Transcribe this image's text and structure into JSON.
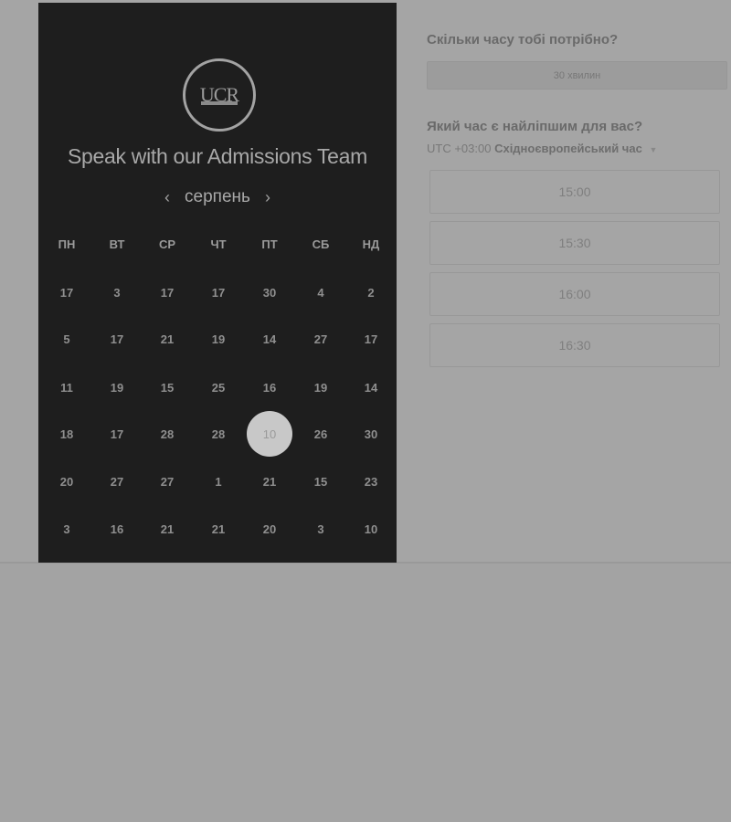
{
  "left": {
    "logo_text": "UCR",
    "headline": "Speak with our Admissions Team",
    "month": "серпень",
    "prev_arrow": "‹",
    "next_arrow": "›",
    "weekdays": [
      "ПН",
      "ВТ",
      "СР",
      "ЧТ",
      "ПТ",
      "СБ",
      "НД"
    ],
    "weeks": [
      [
        "17",
        "3",
        "17",
        "17",
        "30",
        "4",
        "2"
      ],
      [
        "5",
        "17",
        "21",
        "19",
        "14",
        "27",
        "17"
      ],
      [
        "11",
        "19",
        "15",
        "25",
        "16",
        "19",
        "14"
      ],
      [
        "18",
        "17",
        "28",
        "28",
        "10",
        "26",
        "30"
      ],
      [
        "20",
        "27",
        "27",
        "1",
        "21",
        "15",
        "23"
      ],
      [
        "3",
        "16",
        "21",
        "21",
        "20",
        "3",
        "10"
      ]
    ],
    "selected_day": "10"
  },
  "right": {
    "duration_question": "Скільки часу тобі потрібно?",
    "duration_value": "30 хвилин",
    "time_question": "Який час є найліпшим для вас?",
    "tz_offset": "UTC +03:00",
    "tz_name": "Східноєвропейський час",
    "tz_caret": "▼",
    "slots": [
      "15:00",
      "15:30",
      "16:00",
      "16:30"
    ]
  }
}
